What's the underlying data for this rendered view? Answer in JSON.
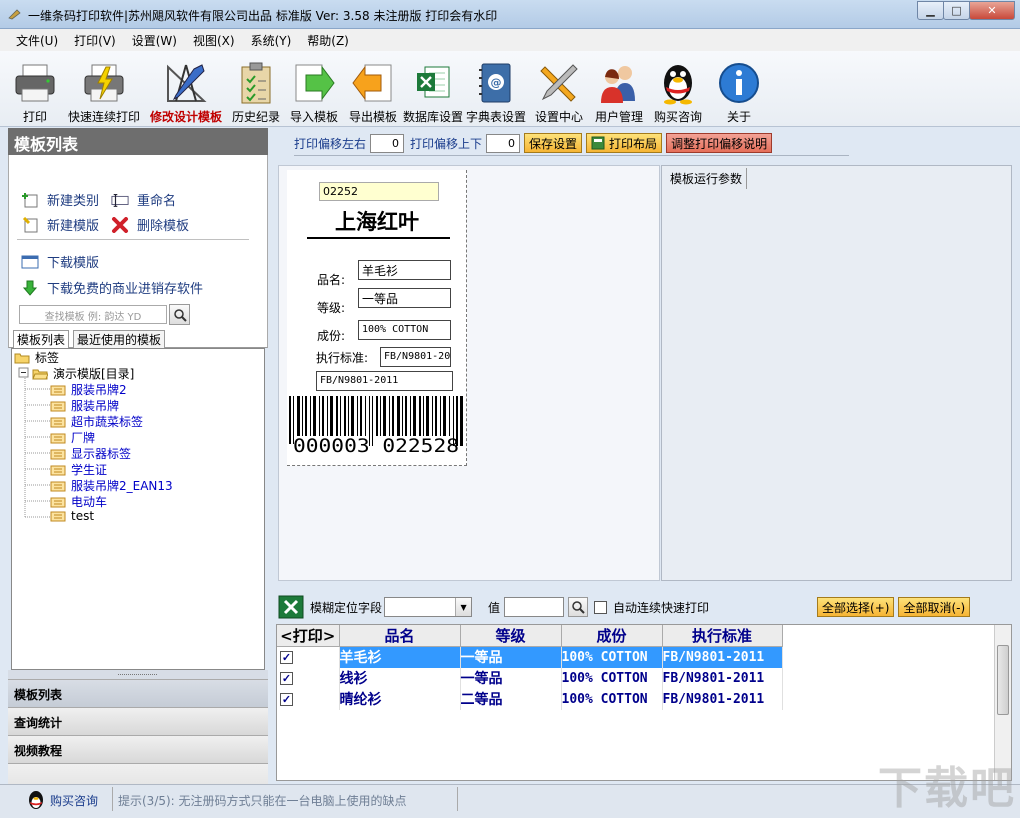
{
  "window": {
    "title": "一维条码打印软件|苏州飓风软件有限公司出品 标准版 Ver: 3.58 未注册版 打印会有水印"
  },
  "menu": [
    "文件(U)",
    "打印(V)",
    "设置(W)",
    "视图(X)",
    "系统(Y)",
    "帮助(Z)"
  ],
  "toolbar": {
    "print": "打印",
    "fast_print": "快速连续打印",
    "edit_template": "修改设计模板",
    "history": "历史纪录",
    "import": "导入模板",
    "export": "导出模板",
    "db_settings": "数据库设置",
    "dict_settings": "字典表设置",
    "settings_center": "设置中心",
    "user_mgmt": "用户管理",
    "buy": "购买咨询",
    "about": "关于"
  },
  "left": {
    "header": "模板列表",
    "new_category": "新建类别",
    "rename": "重命名",
    "new_template": "新建模版",
    "delete_template": "删除模板",
    "download_template": "下载模版",
    "download_software": "下载免费的商业进销存软件",
    "search_placeholder": "查找模板  例: 韵达 YD",
    "tab_list": "模板列表",
    "tab_recent": "最近使用的模板",
    "tree": {
      "root1": "标签",
      "root2": "演示模版[目录]",
      "children": [
        "服装吊牌2",
        "服装吊牌",
        "超市蔬菜标签",
        "厂牌",
        "显示器标签",
        "学生证",
        "服装吊牌2_EAN13",
        "电动车",
        "test"
      ]
    },
    "accordion": [
      "模板列表",
      "查询统计",
      "视频教程"
    ]
  },
  "offset": {
    "lr_label": "打印偏移左右",
    "lr_value": "0",
    "ud_label": "打印偏移上下",
    "ud_value": "0",
    "save": "保存设置",
    "layout": "打印布局",
    "help": "调整打印偏移说明"
  },
  "label": {
    "code": "02252",
    "title": "上海红叶",
    "name_key": "品名:",
    "name_val": "羊毛衫",
    "grade_key": "等级:",
    "grade_val": "一等品",
    "comp_key": "成份:",
    "comp_val": "100% COTTON",
    "std_key": "执行标准:",
    "std_val": "FB/N9801-20",
    "std_full": "FB/N9801-2011",
    "barcode_text": "000003 022528"
  },
  "params": {
    "header": "模板运行参数"
  },
  "gridbar": {
    "locate_label": "模糊定位字段",
    "value_label": "值",
    "auto_print": "自动连续快速打印",
    "select_all": "全部选择(+)",
    "deselect_all": "全部取消(-)"
  },
  "grid": {
    "headers": [
      "<打印>",
      "品名",
      "等级",
      "成份",
      "执行标准"
    ],
    "rows": [
      {
        "name": "羊毛衫",
        "grade": "一等品",
        "comp": "100% COTTON",
        "std": "FB/N9801-2011"
      },
      {
        "name": "线衫",
        "grade": "一等品",
        "comp": "100% COTTON",
        "std": "FB/N9801-2011"
      },
      {
        "name": "晴纶衫",
        "grade": "二等品",
        "comp": "100% COTTON",
        "std": "FB/N9801-2011"
      }
    ]
  },
  "status": {
    "buy": "购买咨询",
    "tip": "提示(3/5): 无注册码方式只能在一台电脑上使用的缺点",
    "watermark": "下载吧"
  }
}
